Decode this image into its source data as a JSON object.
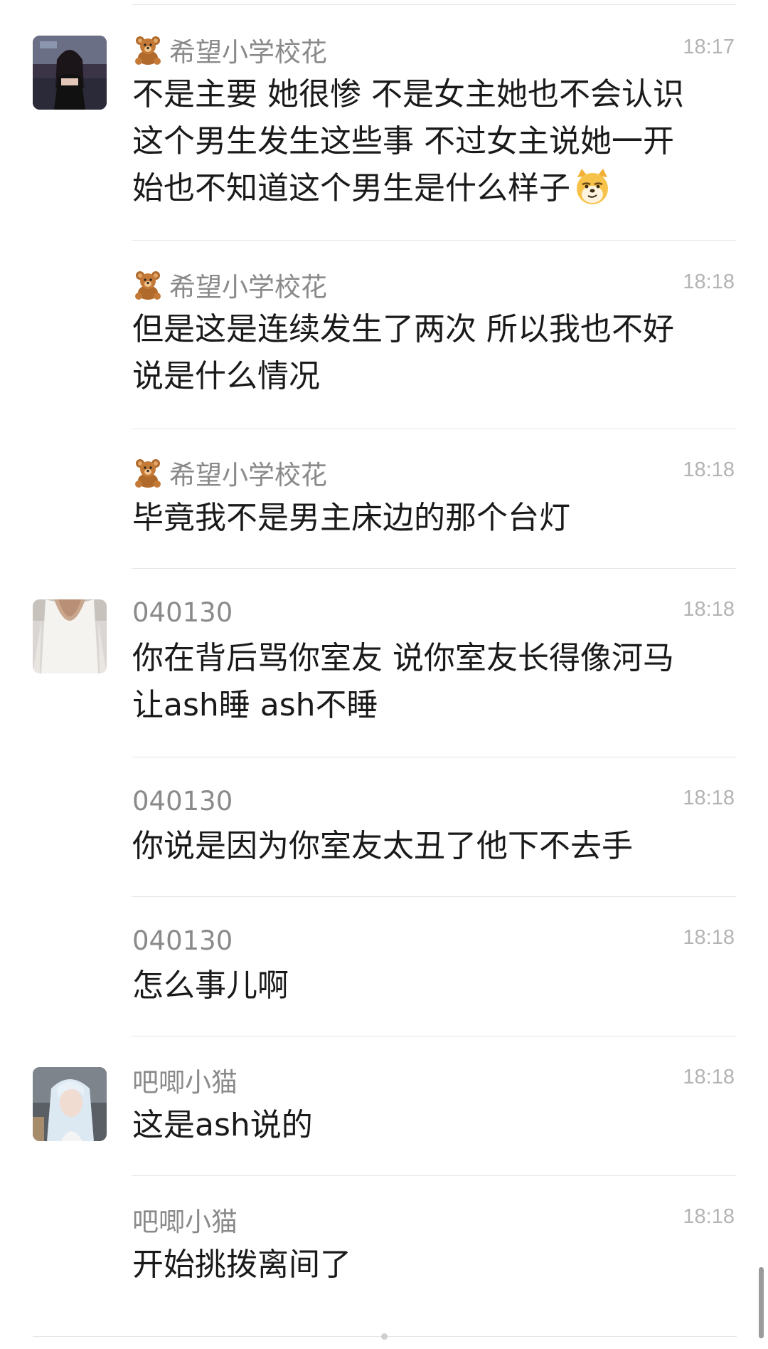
{
  "messages": [
    {
      "sender": "希望小学校花",
      "time": "18:17",
      "lines": [
        "不是主要 她很惨 不是女主她也不会认识",
        "这个男生发生这些事 不过女主说她一开",
        "始也不知道这个男生是什么样子"
      ]
    },
    {
      "sender": "希望小学校花",
      "time": "18:18",
      "lines": [
        "但是这是连续发生了两次 所以我也不好",
        "说是什么情况"
      ]
    },
    {
      "sender": "希望小学校花",
      "time": "18:18",
      "lines": [
        "毕竟我不是男主床边的那个台灯"
      ]
    },
    {
      "sender": "040130",
      "time": "18:18",
      "lines": [
        "你在背后骂你室友 说你室友长得像河马",
        "让ash睡 ash不睡"
      ]
    },
    {
      "sender": "040130",
      "time": "18:18",
      "lines": [
        "你说是因为你室友太丑了他下不去手"
      ]
    },
    {
      "sender": "040130",
      "time": "18:18",
      "lines": [
        "怎么事儿啊"
      ]
    },
    {
      "sender": "吧唧小猫",
      "time": "18:18",
      "lines": [
        "这是ash说的"
      ]
    },
    {
      "sender": "吧唧小猫",
      "time": "18:18",
      "lines": [
        "开始挑拨离间了"
      ]
    }
  ],
  "icons": {
    "badge": "teddy-bear-icon",
    "emoji": "smirking-doge-emoji"
  },
  "colors": {
    "sender": "#8a8a8a",
    "time": "#b3b3b3",
    "text": "#1a1a1a",
    "divider": "#e6e6e6"
  }
}
